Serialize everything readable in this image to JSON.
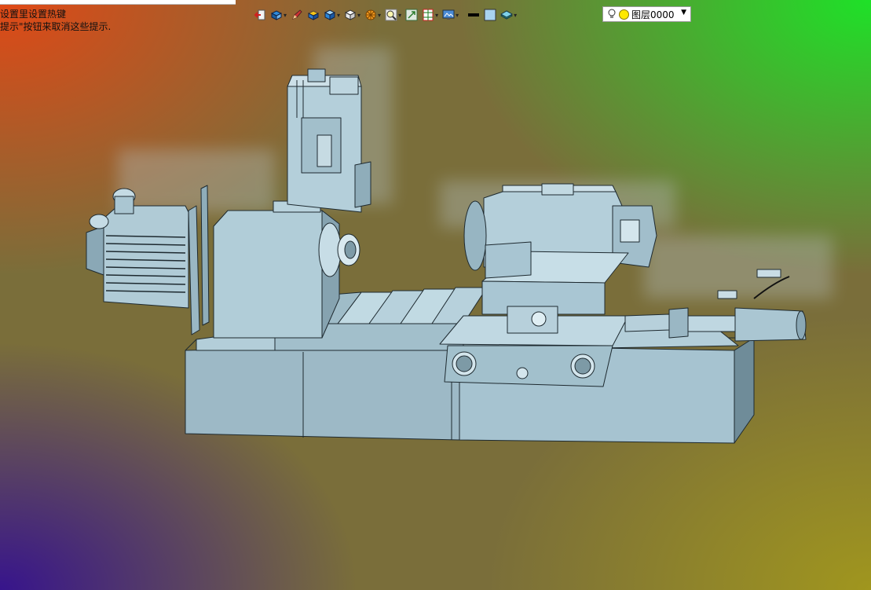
{
  "hint": {
    "line1": "设置里设置热键",
    "line2": "提示\"按钮来取消这些提示."
  },
  "toolbar": {
    "items": [
      {
        "icon": "exit-sketch-icon",
        "dropdown": false
      },
      {
        "icon": "view-orientation-icon",
        "dropdown": true
      },
      {
        "icon": "pencil-icon",
        "dropdown": false
      },
      {
        "icon": "shaded-part-icon",
        "dropdown": false
      },
      {
        "icon": "display-style-icon",
        "dropdown": true
      },
      {
        "icon": "cube-view-icon",
        "dropdown": true
      },
      {
        "icon": "section-view-icon",
        "dropdown": true
      },
      {
        "icon": "zoom-icon",
        "dropdown": true
      },
      {
        "icon": "fit-view-icon",
        "dropdown": false
      },
      {
        "icon": "layout-icon",
        "dropdown": true
      },
      {
        "icon": "monitor-scene-icon",
        "dropdown": true
      },
      {
        "icon": "line-thickness-icon",
        "dropdown": false
      },
      {
        "icon": "color-swatch-icon",
        "dropdown": false
      },
      {
        "icon": "layer-stack-icon",
        "dropdown": true
      }
    ]
  },
  "layer_select": {
    "value": "图层0000"
  },
  "colors": {
    "model_face": "#a9c6d3",
    "model_edge": "#1e2a30",
    "layer_dot": "#ffe800"
  }
}
